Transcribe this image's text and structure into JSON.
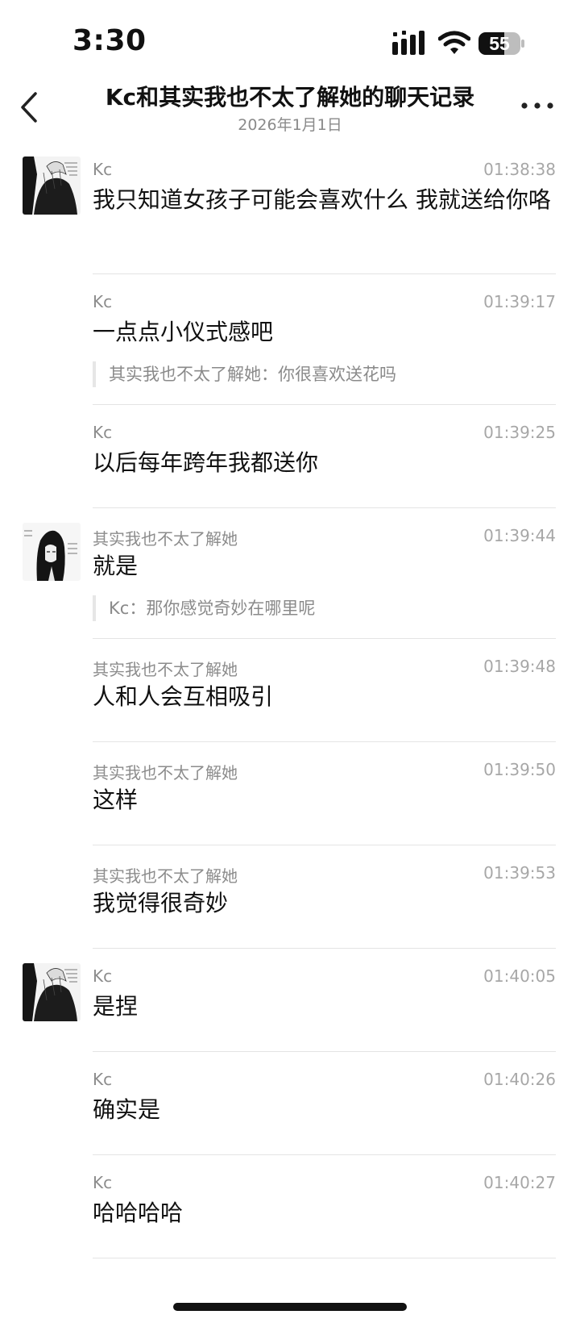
{
  "status_bar": {
    "time": "3:30",
    "battery_level": "55"
  },
  "nav": {
    "title": "Kc和其实我也不太了解她的聊天记录",
    "subtitle": "2026年1月1日",
    "back_icon": "chevron-left-icon",
    "more_icon": "more-icon"
  },
  "messages": [
    {
      "sender": "Kc",
      "time": "01:38:38",
      "text": "我只知道女孩子可能会喜欢什么 我就送给你咯",
      "avatar": "kc-avatar"
    },
    {
      "sender": "Kc",
      "time": "01:39:17",
      "text": "一点点小仪式感吧",
      "quote": "其实我也不太了解她：你很喜欢送花吗"
    },
    {
      "sender": "Kc",
      "time": "01:39:25",
      "text": "以后每年跨年我都送你"
    },
    {
      "sender": "其实我也不太了解她",
      "time": "01:39:44",
      "text": "就是",
      "quote": "Kc：那你感觉奇妙在哪里呢",
      "avatar": "other-avatar"
    },
    {
      "sender": "其实我也不太了解她",
      "time": "01:39:48",
      "text": "人和人会互相吸引"
    },
    {
      "sender": "其实我也不太了解她",
      "time": "01:39:50",
      "text": "这样"
    },
    {
      "sender": "其实我也不太了解她",
      "time": "01:39:53",
      "text": "我觉得很奇妙"
    },
    {
      "sender": "Kc",
      "time": "01:40:05",
      "text": "是捏",
      "avatar": "kc-avatar"
    },
    {
      "sender": "Kc",
      "time": "01:40:26",
      "text": "确实是"
    },
    {
      "sender": "Kc",
      "time": "01:40:27",
      "text": "哈哈哈哈"
    }
  ],
  "colors": {
    "text": "#111111",
    "meta": "#8c8c8c",
    "timestamp": "#a7a7a7",
    "divider": "#e4e4e4",
    "background": "#ffffff"
  }
}
